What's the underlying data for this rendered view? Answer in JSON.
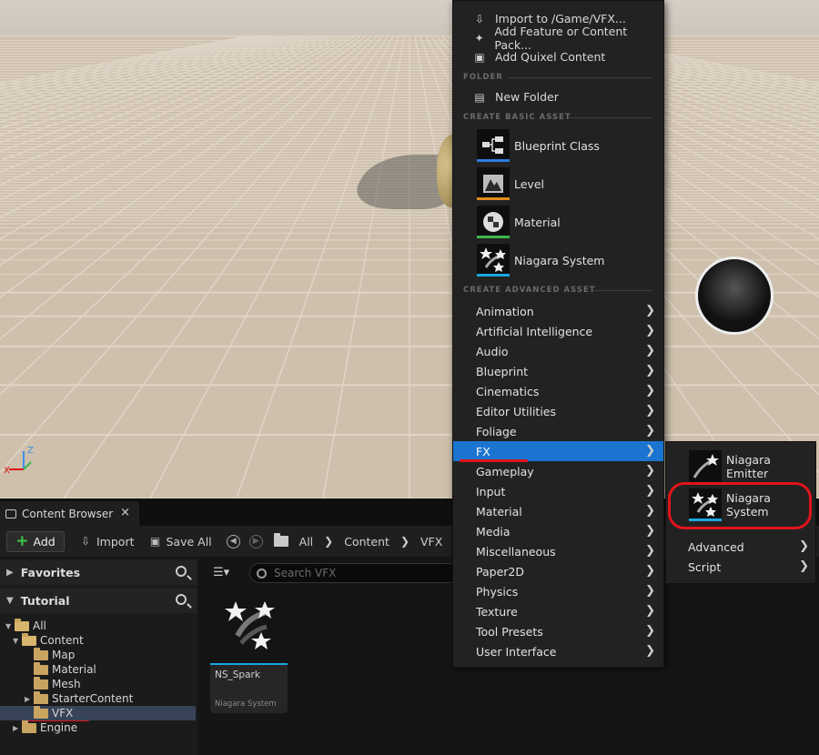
{
  "viewport": {
    "axis_labels": {
      "z": "Z",
      "x": "X"
    }
  },
  "content_browser": {
    "tab_label": "Content Browser",
    "tab_close": "×",
    "toolbar": {
      "add_label": "Add",
      "import_label": "Import",
      "save_all_label": "Save All",
      "breadcrumb": [
        "All",
        "Content",
        "VFX"
      ]
    },
    "favorites_label": "Favorites",
    "tutorial_label": "Tutorial",
    "tree": [
      {
        "label": "All",
        "depth": 0
      },
      {
        "label": "Content",
        "depth": 1
      },
      {
        "label": "Map",
        "depth": 2
      },
      {
        "label": "Material",
        "depth": 2
      },
      {
        "label": "Mesh",
        "depth": 2
      },
      {
        "label": "StarterContent",
        "depth": 2
      },
      {
        "label": "VFX",
        "depth": 2
      },
      {
        "label": "Engine",
        "depth": 1
      }
    ],
    "search_placeholder": "Search VFX",
    "asset": {
      "name": "NS_Spark",
      "type": "Niagara System"
    }
  },
  "menu": {
    "top_items": [
      "Import to /Game/VFX...",
      "Add Feature or Content Pack...",
      "Add Quixel Content"
    ],
    "folder_heading": "FOLDER",
    "new_folder": "New Folder",
    "basic_heading": "CREATE BASIC ASSET",
    "basic_items": [
      {
        "label": "Blueprint Class",
        "color": "#2d7be0"
      },
      {
        "label": "Level",
        "color": "#e08a1a"
      },
      {
        "label": "Material",
        "color": "#3cb84a"
      },
      {
        "label": "Niagara System",
        "color": "#1aa6e0"
      }
    ],
    "advanced_heading": "CREATE ADVANCED ASSET",
    "advanced_items": [
      "Animation",
      "Artificial Intelligence",
      "Audio",
      "Blueprint",
      "Cinematics",
      "Editor Utilities",
      "Foliage",
      "FX",
      "Gameplay",
      "Input",
      "Material",
      "Media",
      "Miscellaneous",
      "Paper2D",
      "Physics",
      "Texture",
      "Tool Presets",
      "User Interface"
    ],
    "highlighted": "FX",
    "highlight_color": "#1b75d0"
  },
  "submenu": {
    "items": [
      "Niagara Emitter",
      "Niagara System"
    ],
    "more": [
      "Advanced",
      "Script"
    ]
  },
  "annotation_color": "#e0141a"
}
